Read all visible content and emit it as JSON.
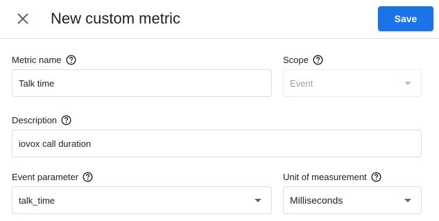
{
  "header": {
    "title": "New custom metric",
    "save_label": "Save"
  },
  "form": {
    "metric_name": {
      "label": "Metric name",
      "value": "Talk time"
    },
    "scope": {
      "label": "Scope",
      "value": "Event"
    },
    "description": {
      "label": "Description",
      "value": "iovox call duration"
    },
    "event_parameter": {
      "label": "Event parameter",
      "value": "talk_time"
    },
    "unit_of_measurement": {
      "label": "Unit of measurement",
      "value": "Milliseconds"
    }
  },
  "icons": {
    "close": "close-icon",
    "help": "help-circle-icon",
    "dropdown": "dropdown-arrow-icon"
  },
  "colors": {
    "primary": "#1a73e8",
    "border": "#dadce0",
    "disabled_text": "#9aa0a6",
    "text": "#202124"
  }
}
